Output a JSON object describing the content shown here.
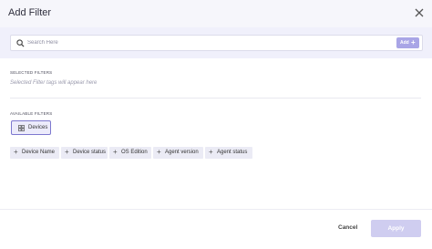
{
  "header": {
    "title": "Add Filter",
    "close_icon": "close-icon"
  },
  "search": {
    "placeholder": "Search Here",
    "value": "",
    "add_label": "Add",
    "add_icon": "plus-icon"
  },
  "selected": {
    "label": "SELECTED FILTERS",
    "hint": "Selected Filter tags will appear here"
  },
  "available": {
    "label": "AVAILABLE FILTERS",
    "category": {
      "label": "Devices",
      "icon": "devices-icon"
    },
    "filters": [
      {
        "label": "Device Name"
      },
      {
        "label": "Device status"
      },
      {
        "label": "OS Edition"
      },
      {
        "label": "Agent version"
      },
      {
        "label": "Agent status"
      }
    ]
  },
  "footer": {
    "cancel_label": "Cancel",
    "apply_label": "Apply"
  },
  "colors": {
    "accent": "#7d78cf",
    "accent_light": "#a9a5e6",
    "apply_disabled": "#cfcdf0",
    "chip_bg": "#ebebf5"
  }
}
